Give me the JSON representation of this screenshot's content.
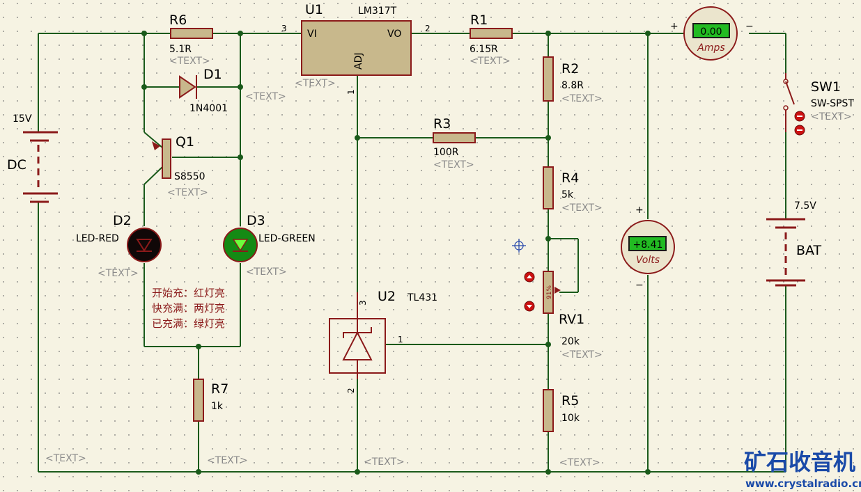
{
  "supply": {
    "name": "DC",
    "voltage": "15V"
  },
  "battery": {
    "name": "BAT",
    "voltage": "7.5V"
  },
  "regulator": {
    "ref": "U1",
    "part": "LM317T",
    "pin_vi": "VI",
    "pin_vo": "VO",
    "pin_adj": "ADJ",
    "pin3": "3",
    "pin2": "2",
    "pin1": "1"
  },
  "shunt": {
    "ref": "U2",
    "part": "TL431",
    "pin1": "1",
    "pin2": "2",
    "pin3": "3"
  },
  "resistors": {
    "r6": {
      "ref": "R6",
      "value": "5.1R"
    },
    "r1": {
      "ref": "R1",
      "value": "6.15R"
    },
    "r2": {
      "ref": "R2",
      "value": "8.8R"
    },
    "r3": {
      "ref": "R3",
      "value": "100R"
    },
    "r4": {
      "ref": "R4",
      "value": "5k"
    },
    "r5": {
      "ref": "R5",
      "value": "10k"
    },
    "r7": {
      "ref": "R7",
      "value": "1k"
    }
  },
  "pot": {
    "ref": "RV1",
    "value": "20k",
    "position": "91%"
  },
  "diode": {
    "ref": "D1",
    "part": "1N4001"
  },
  "transistor": {
    "ref": "Q1",
    "part": "S8550"
  },
  "led_red": {
    "ref": "D2",
    "part": "LED-RED"
  },
  "led_green": {
    "ref": "D3",
    "part": "LED-GREEN"
  },
  "switch": {
    "ref": "SW1",
    "part": "SW-SPST"
  },
  "ammeter": {
    "reading": "0.00",
    "unit": "Amps",
    "plus": "+",
    "minus": "−"
  },
  "voltmeter": {
    "reading": "+8.41",
    "unit": "Volts",
    "plus": "+",
    "minus": "−"
  },
  "placeholder": "<TEXT>",
  "note": [
    "开始充：红灯亮",
    "快充满：两灯亮",
    "已充满：绿灯亮"
  ],
  "watermark": {
    "logo": "矿石收音机",
    "url": "www.crystalradio.cn"
  },
  "colors": {
    "wire": "#1a5a1a",
    "component": "#8b1a1a",
    "body": "#c8b88c",
    "background": "#f6f3e3",
    "meter_display": "#22bb22"
  }
}
